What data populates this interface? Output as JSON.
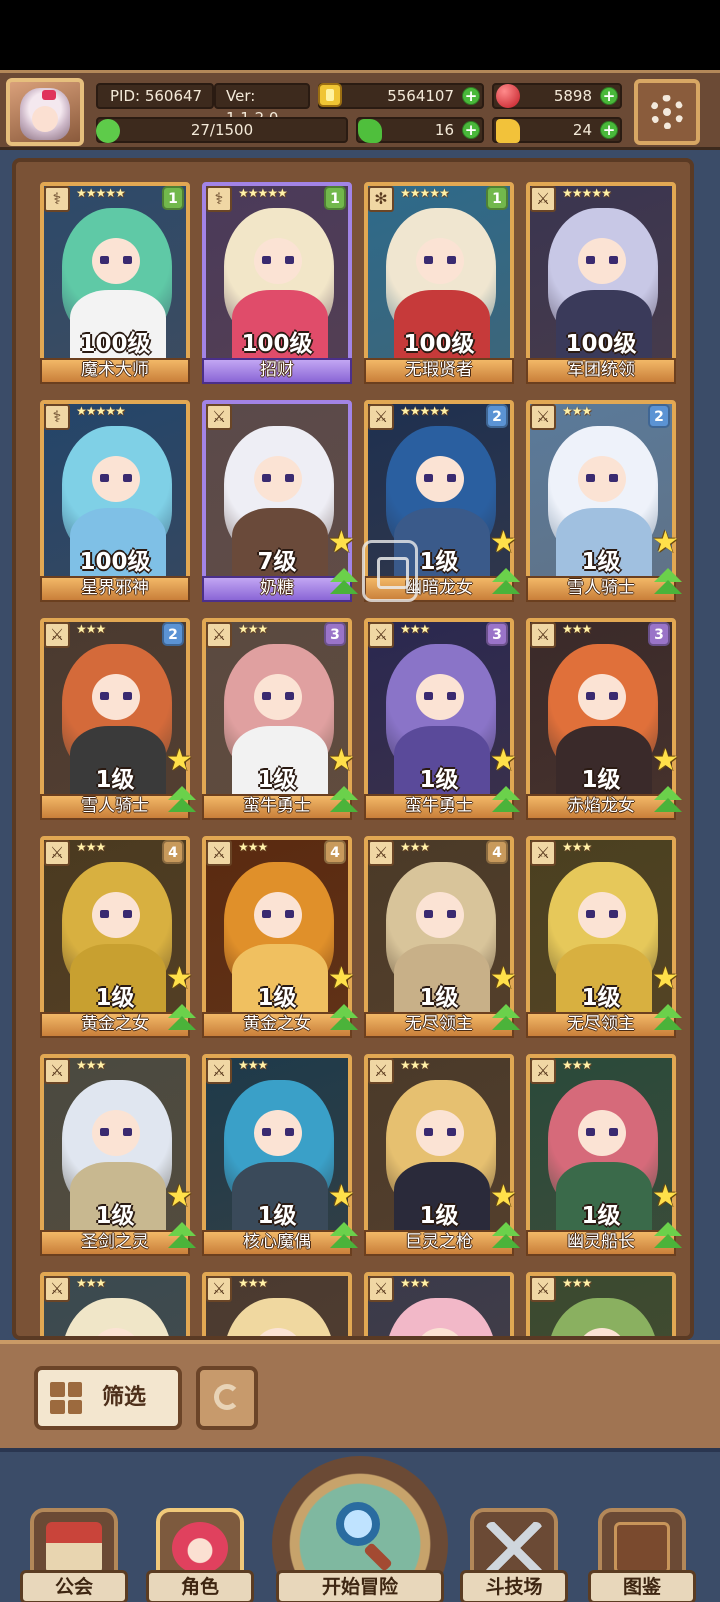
{
  "header": {
    "pid": "PID: 560647",
    "version": "Ver: 1.1.2.0",
    "gold": "5564107",
    "gems": "5898",
    "exp": "27/1500",
    "clover": "16",
    "thumb": "24",
    "plus_symbol": "+"
  },
  "cards": [
    {
      "name": "魔术大师",
      "level": "100级",
      "stars": "★★★★★",
      "rank": "1",
      "type": "⚕",
      "theme": "gold"
    },
    {
      "name": "招财",
      "level": "100级",
      "stars": "★★★★★",
      "rank": "1",
      "type": "⚕",
      "theme": "purple"
    },
    {
      "name": "无瑕贤者",
      "level": "100级",
      "stars": "★★★★★",
      "rank": "1",
      "type": "✻",
      "theme": "gold"
    },
    {
      "name": "军团统领",
      "level": "100级",
      "stars": "★★★★★",
      "rank": "",
      "type": "⚔",
      "theme": "gold"
    },
    {
      "name": "星界邪神",
      "level": "100级",
      "stars": "★★★★★",
      "rank": "",
      "type": "⚕",
      "theme": "gold"
    },
    {
      "name": "奶糖",
      "level": "7级",
      "stars": "",
      "rank": "",
      "type": "⚔",
      "theme": "purple"
    },
    {
      "name": "幽暗龙女",
      "level": "1级",
      "stars": "★★★★★",
      "rank": "2",
      "type": "⚔",
      "theme": "gold"
    },
    {
      "name": "雪人骑士",
      "level": "1级",
      "stars": "★★★",
      "rank": "2",
      "type": "⚔",
      "theme": "gold"
    },
    {
      "name": "雪人骑士",
      "level": "1级",
      "stars": "★★★",
      "rank": "2",
      "type": "⚔",
      "theme": "gold"
    },
    {
      "name": "蛮牛勇士",
      "level": "1级",
      "stars": "★★★",
      "rank": "3",
      "type": "⚔",
      "theme": "gold"
    },
    {
      "name": "蛮牛勇士",
      "level": "1级",
      "stars": "★★★",
      "rank": "3",
      "type": "⚔",
      "theme": "gold"
    },
    {
      "name": "赤焰龙女",
      "level": "1级",
      "stars": "★★★",
      "rank": "3",
      "type": "⚔",
      "theme": "gold"
    },
    {
      "name": "黄金之女",
      "level": "1级",
      "stars": "★★★",
      "rank": "4",
      "type": "⚔",
      "theme": "gold"
    },
    {
      "name": "黄金之女",
      "level": "1级",
      "stars": "★★★",
      "rank": "4",
      "type": "⚔",
      "theme": "gold"
    },
    {
      "name": "无尽领主",
      "level": "1级",
      "stars": "★★★",
      "rank": "4",
      "type": "⚔",
      "theme": "gold"
    },
    {
      "name": "无尽领主",
      "level": "1级",
      "stars": "★★★",
      "rank": "",
      "type": "⚔",
      "theme": "gold"
    },
    {
      "name": "圣剑之灵",
      "level": "1级",
      "stars": "★★★",
      "rank": "",
      "type": "⚔",
      "theme": "gold"
    },
    {
      "name": "核心魔偶",
      "level": "1级",
      "stars": "★★★",
      "rank": "",
      "type": "⚔",
      "theme": "gold"
    },
    {
      "name": "巨灵之枪",
      "level": "1级",
      "stars": "★★★",
      "rank": "",
      "type": "⚔",
      "theme": "gold"
    },
    {
      "name": "幽灵船长",
      "level": "1级",
      "stars": "★★★",
      "rank": "",
      "type": "⚔",
      "theme": "gold"
    },
    {
      "name": "",
      "level": "",
      "stars": "★★★",
      "rank": "",
      "type": "⚔",
      "theme": "gold"
    },
    {
      "name": "",
      "level": "",
      "stars": "★★★",
      "rank": "",
      "type": "⚔",
      "theme": "gold"
    },
    {
      "name": "",
      "level": "",
      "stars": "★★★",
      "rank": "",
      "type": "⚔",
      "theme": "gold"
    },
    {
      "name": "",
      "level": "",
      "stars": "★★★",
      "rank": "",
      "type": "⚔",
      "theme": "gold"
    }
  ],
  "filter": {
    "label": "筛选"
  },
  "nav": {
    "guild": "公会",
    "role": "角色",
    "adventure": "开始冒险",
    "arena": "斗技场",
    "codex": "图鉴"
  }
}
